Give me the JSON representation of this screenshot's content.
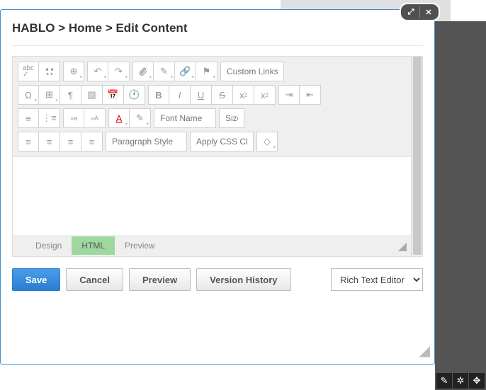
{
  "breadcrumb": {
    "site": "HABLO",
    "page": "Home",
    "action": "Edit Content",
    "sep": " > "
  },
  "toolbar": {
    "custom_links": "Custom Links",
    "font_name": "Font Name",
    "size": "Size",
    "paragraph_style": "Paragraph Style",
    "apply_css": "Apply CSS Cla"
  },
  "tabs": {
    "design": "Design",
    "html": "HTML",
    "preview": "Preview",
    "active": "html"
  },
  "actions": {
    "save": "Save",
    "cancel": "Cancel",
    "preview": "Preview",
    "version_history": "Version History",
    "editor_select": "Rich Text Editor"
  }
}
